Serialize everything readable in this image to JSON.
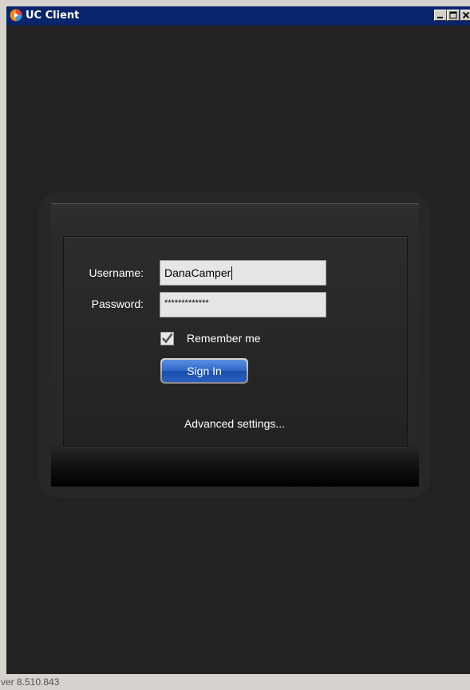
{
  "window": {
    "title": "UC Client",
    "app_icon": "uc-client-logo-icon",
    "controls": [
      "minimize-icon",
      "maximize-icon",
      "close-icon"
    ]
  },
  "login": {
    "username_label": "Username:",
    "username_value": "DanaCamper",
    "password_label": "Password:",
    "password_value": "*************",
    "remember_label": "Remember me",
    "remember_checked": true,
    "signin_label": "Sign In",
    "advanced_label": "Advanced settings..."
  },
  "status": {
    "version": "ver 8.510.843"
  },
  "colors": {
    "titlebar": "#08246b",
    "background": "#222222",
    "signin_button": "#2d66c8"
  }
}
